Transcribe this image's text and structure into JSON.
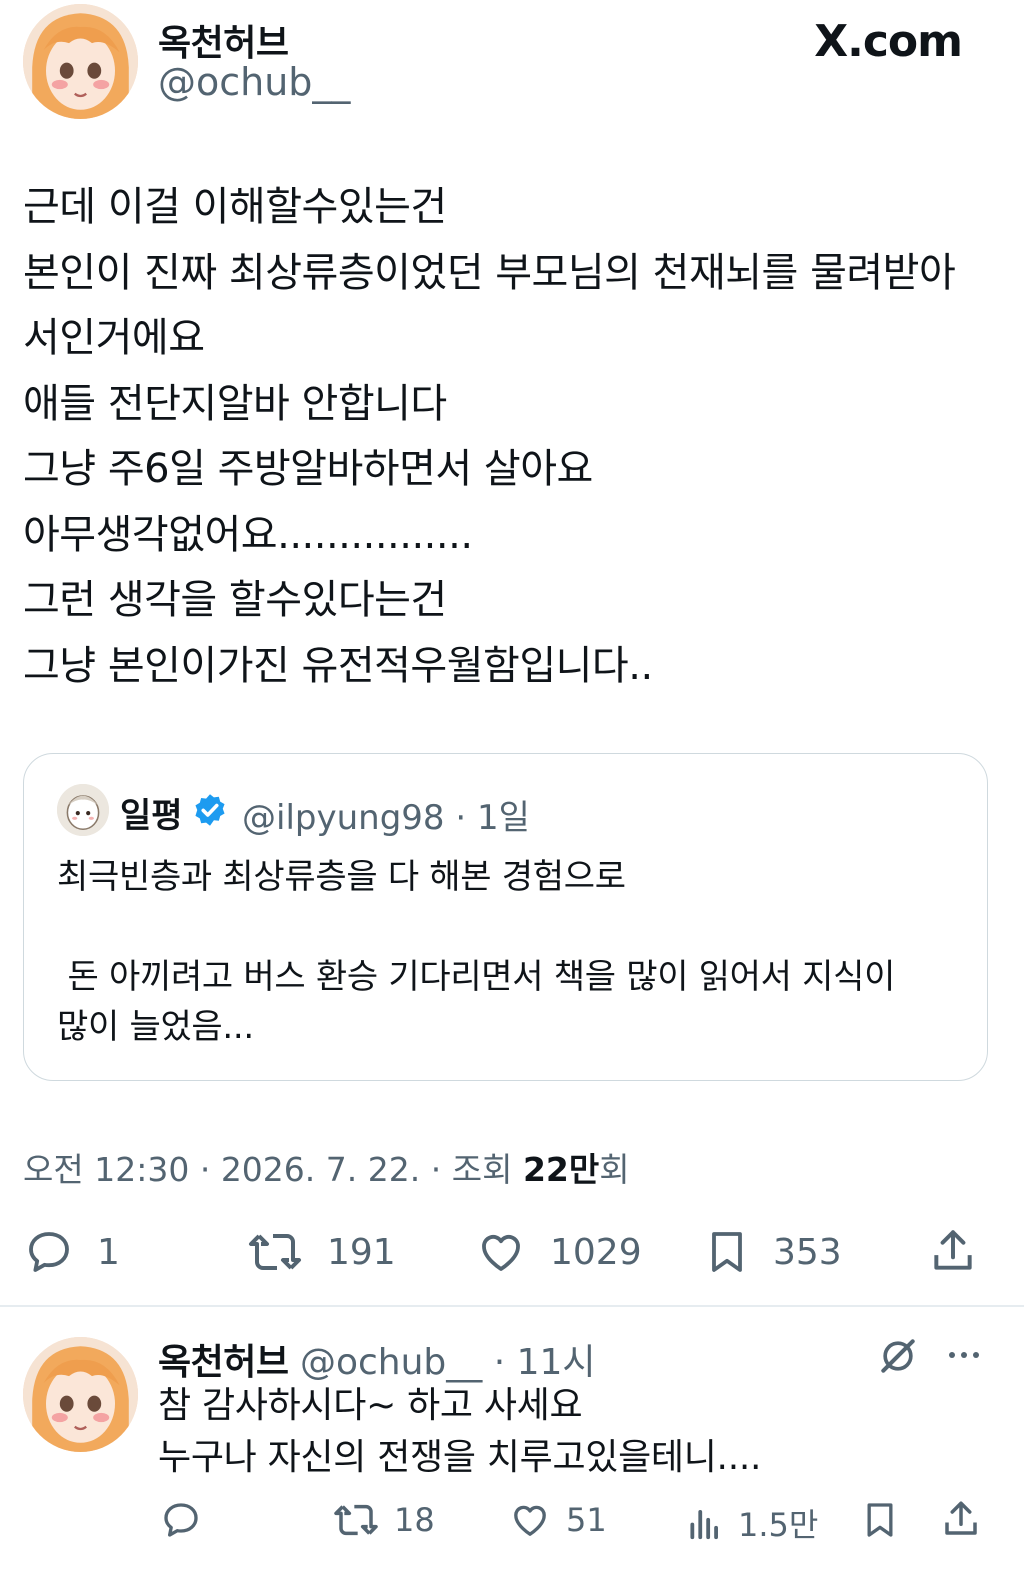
{
  "header": {
    "display_name": "옥천허브",
    "handle": "@ochub__",
    "site_logo": "X.com"
  },
  "tweet": {
    "lines": [
      "근데 이걸 이해할수있는건",
      "본인이 진짜 최상류층이었던 부모님의 천재뇌를 물려받아",
      "서인거에요",
      "애들 전단지알바 안합니다",
      "그냥 주6일 주방알바하면서 살아요",
      "아무생각없어요................",
      "그런 생각을 할수있다는건",
      "그냥 본인이가진 유전적우월함입니다.."
    ]
  },
  "quote": {
    "name": "일평",
    "handle": "@ilpyung98",
    "separator": "·",
    "time": "1일",
    "lines": [
      "최극빈층과 최상류층을 다 해본 경험으로",
      "",
      " 돈 아끼려고 버스 환승 기다리면서 책을 많이 읽어서 지식이",
      "많이 늘었음..."
    ],
    "verified_icon": "verified-badge-icon"
  },
  "meta": {
    "time": "오전 12:30",
    "separator": "·",
    "date": "2026. 7. 22.",
    "views_label": "조회",
    "views_value": "22만",
    "views_suffix": "회"
  },
  "actions": {
    "replies": "1",
    "reposts": "191",
    "likes": "1029",
    "bookmarks": "353"
  },
  "reply": {
    "name": "옥천허브",
    "handle": "@ochub__",
    "separator": "·",
    "time": "11시",
    "lines": [
      "참 감사하시다~ 하고 사세요",
      "누구나 자신의 전쟁을 치루고있을테니...."
    ],
    "actions": {
      "reposts": "18",
      "likes": "51",
      "views": "1.5만"
    }
  },
  "colors": {
    "text": "#0f1419",
    "secondary": "#536471",
    "border": "#cfd9de",
    "verified": "#1d9bf0"
  }
}
